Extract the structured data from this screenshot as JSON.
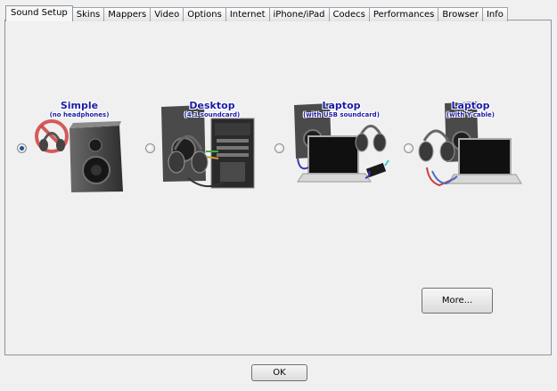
{
  "tabs": [
    {
      "label": "Sound Setup",
      "active": true
    },
    {
      "label": "Skins",
      "active": false
    },
    {
      "label": "Mappers",
      "active": false
    },
    {
      "label": "Video",
      "active": false
    },
    {
      "label": "Options",
      "active": false
    },
    {
      "label": "Internet",
      "active": false
    },
    {
      "label": "iPhone/iPad",
      "active": false
    },
    {
      "label": "Codecs",
      "active": false
    },
    {
      "label": "Performances",
      "active": false
    },
    {
      "label": "Browser",
      "active": false
    },
    {
      "label": "Info",
      "active": false
    }
  ],
  "options": [
    {
      "title": "Simple",
      "subtitle": "(no headphones)",
      "selected": true,
      "icon": "speaker-no-headphones-icon"
    },
    {
      "title": "Desktop",
      "subtitle": "(4.1 soundcard)",
      "selected": false,
      "icon": "desktop-headphones-icon"
    },
    {
      "title": "Laptop",
      "subtitle": "(with USB soundcard)",
      "selected": false,
      "icon": "laptop-usb-soundcard-icon"
    },
    {
      "title": "Laptop",
      "subtitle": "(with Y-cable)",
      "selected": false,
      "icon": "laptop-y-cable-icon"
    }
  ],
  "buttons": {
    "more": "More...",
    "ok": "OK"
  },
  "colors": {
    "title_text": "#1a1aa8",
    "panel_bg": "#f0f0f0"
  }
}
